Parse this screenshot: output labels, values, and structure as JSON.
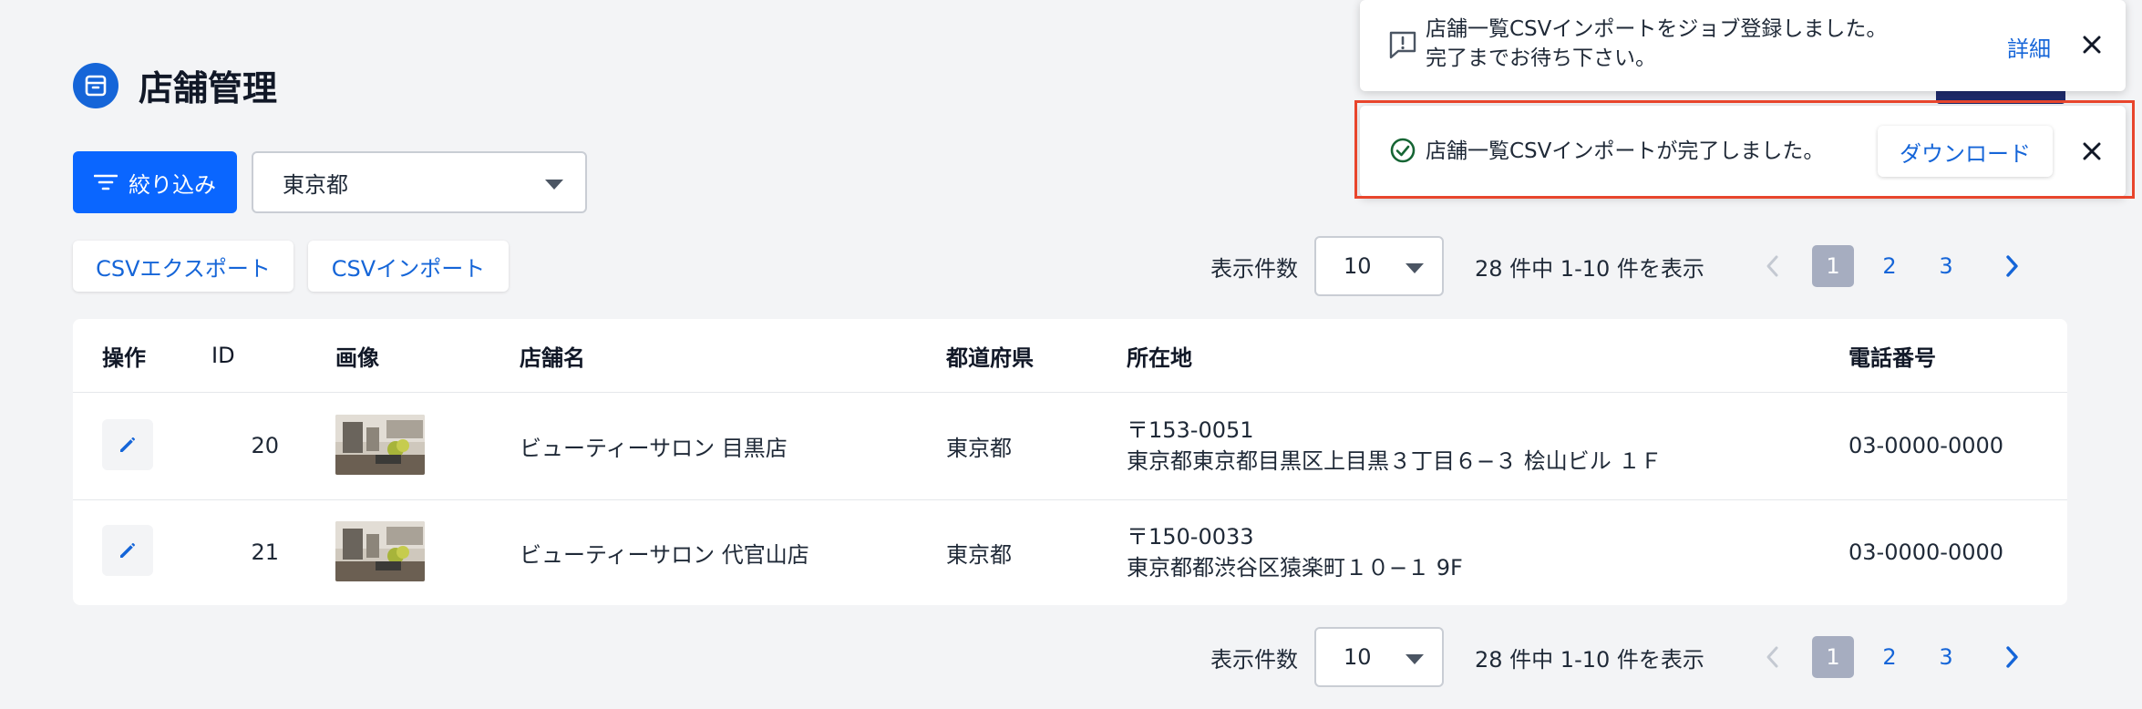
{
  "page": {
    "title": "店舗管理"
  },
  "filter": {
    "button_label": "絞り込み",
    "prefecture_value": "東京都"
  },
  "actions": {
    "csv_export": "CSVエクスポート",
    "csv_import": "CSVインポート"
  },
  "pagination": {
    "per_page_label": "表示件数",
    "per_page_value": "10",
    "count_text": "28 件中  1-10 件を表示",
    "pages": [
      "1",
      "2",
      "3"
    ],
    "current_page": "1"
  },
  "table": {
    "headers": [
      "操作",
      "ID",
      "画像",
      "店舗名",
      "都道府県",
      "所在地",
      "電話番号"
    ],
    "rows": [
      {
        "id": "20",
        "name": "ビューティーサロン 目黒店",
        "prefecture": "東京都",
        "postal": "〒153-0051",
        "address": "東京都東京都目黒区上目黒３丁目６−３ 桧山ビル １Ｆ",
        "phone": "03-0000-0000"
      },
      {
        "id": "21",
        "name": "ビューティーサロン 代官山店",
        "prefecture": "東京都",
        "postal": "〒150-0033",
        "address": "東京都都渋谷区猿楽町１０−１ 9F",
        "phone": "03-0000-0000"
      }
    ]
  },
  "toasts": {
    "job_registered": {
      "line1": "店舗一覧CSVインポートをジョブ登録しました。",
      "line2": "完了までお待ち下さい。",
      "detail_label": "詳細"
    },
    "completed": {
      "message": "店舗一覧CSVインポートが完了しました。",
      "download_label": "ダウンロード"
    }
  },
  "colors": {
    "primary": "#0a66ff",
    "link": "#1565d8",
    "highlight": "#e8452c",
    "active_page": "#a6adc0"
  },
  "icons": {
    "header": "archive-box-icon",
    "filter": "filter-icon",
    "edit": "pencil-icon",
    "alert": "message-alert-icon",
    "success": "check-circle-icon",
    "close": "close-icon",
    "prev": "chevron-left-icon",
    "next": "chevron-right-icon"
  }
}
